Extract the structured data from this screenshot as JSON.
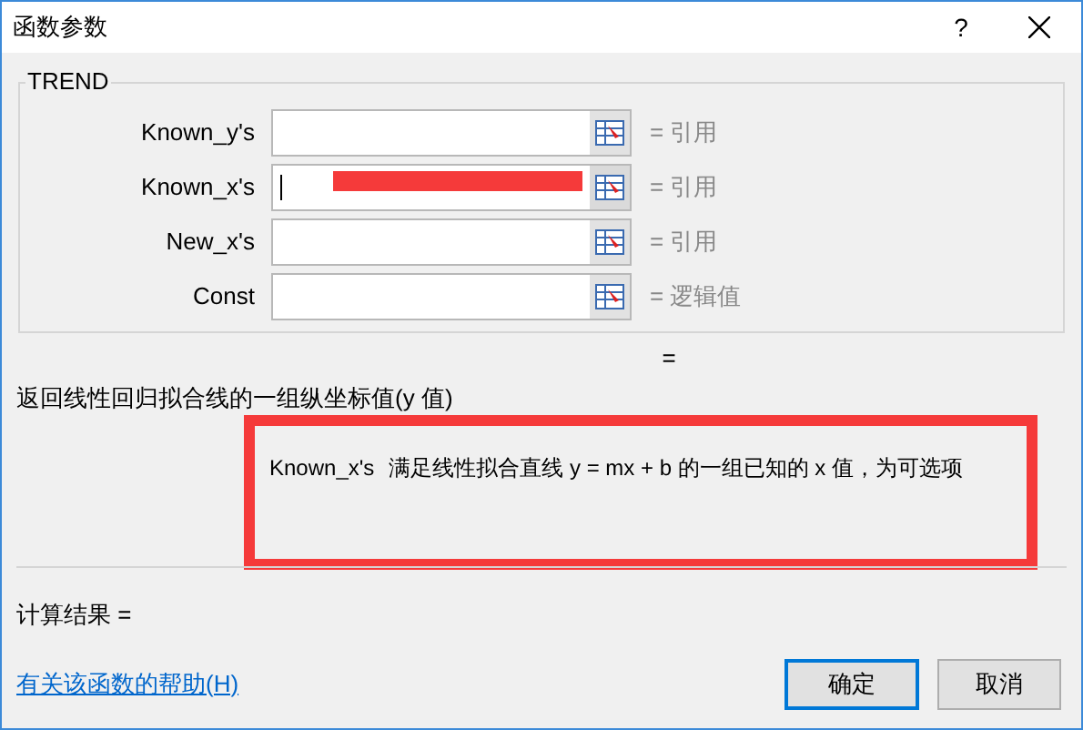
{
  "window": {
    "title": "函数参数",
    "help_glyph": "?"
  },
  "group": {
    "title": "TREND",
    "fields": [
      {
        "label": "Known_y's",
        "focused": false,
        "hint": "= 引用"
      },
      {
        "label": "Known_x's",
        "focused": true,
        "hint": "= 引用"
      },
      {
        "label": "New_x's",
        "focused": false,
        "hint": "= 引用"
      },
      {
        "label": "Const",
        "focused": false,
        "hint": "= 逻辑值"
      }
    ]
  },
  "result_equals": "=",
  "description": "返回线性回归拟合线的一组纵坐标值(y 值)",
  "argument_help": {
    "name": "Known_x's",
    "text": "满足线性拟合直线 y = mx + b 的一组已知的 x 值，为可选项"
  },
  "calculation": "计算结果 =",
  "help_link": "有关该函数的帮助(H)",
  "buttons": [
    {
      "label": "确定",
      "default": true
    },
    {
      "label": "取消",
      "default": false
    }
  ]
}
